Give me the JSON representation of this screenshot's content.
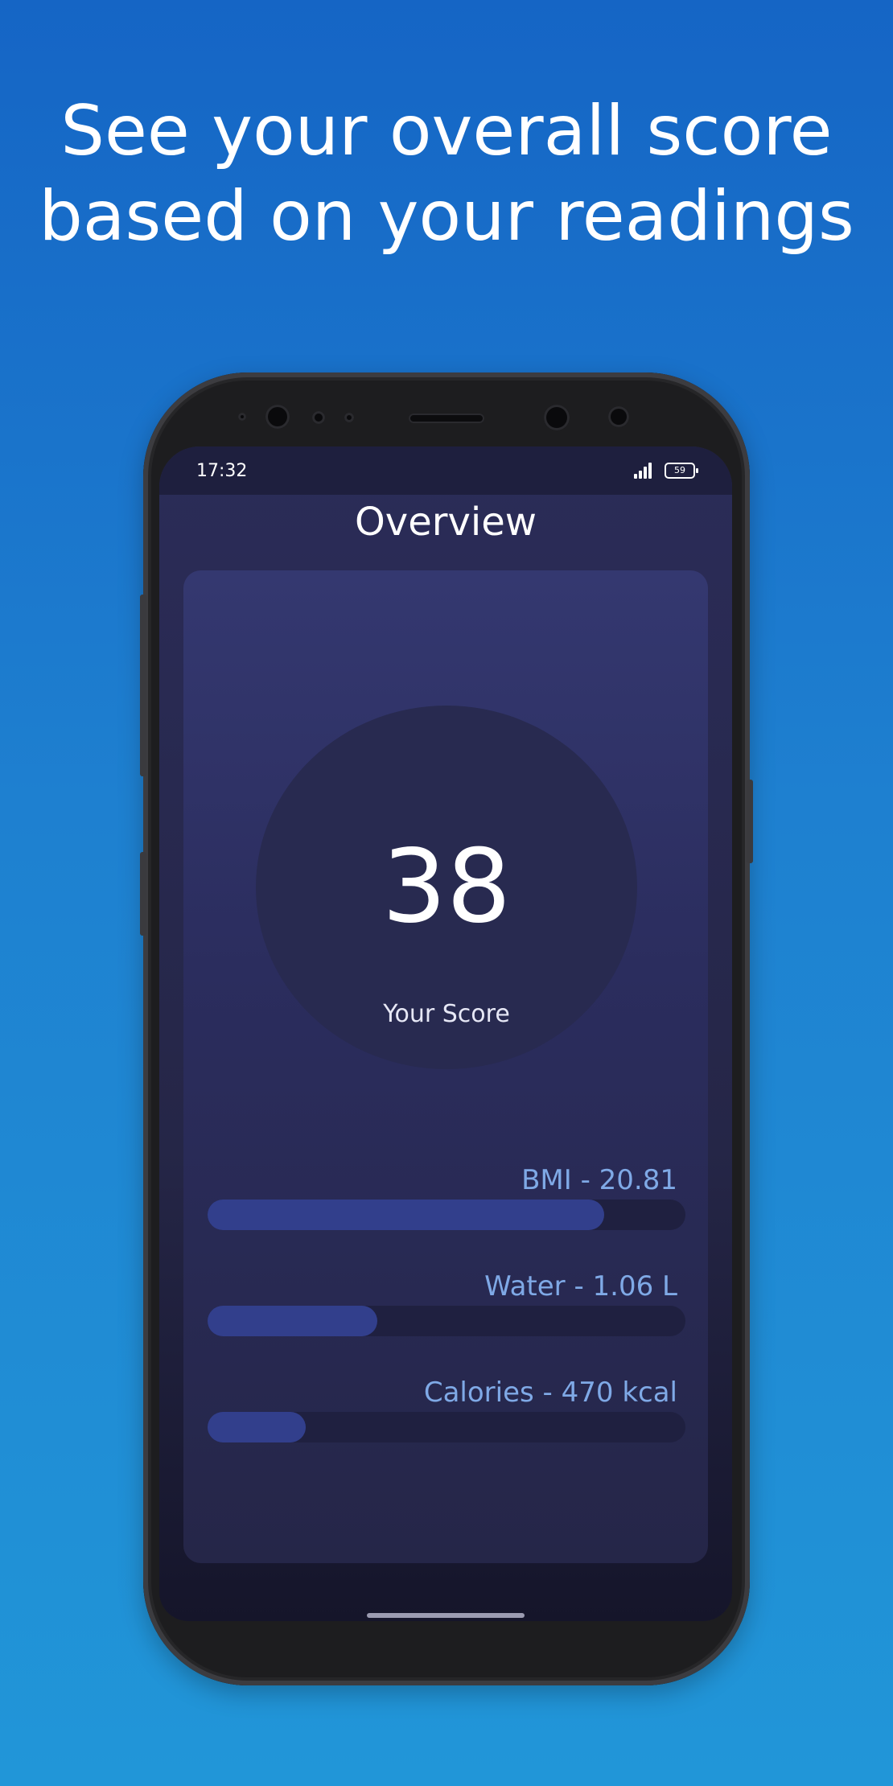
{
  "headline": {
    "line1": "See your overall score",
    "line2": "based on your readings"
  },
  "status_bar": {
    "time": "17:32",
    "battery": "59",
    "icons": [
      "signal-icon",
      "battery-icon"
    ]
  },
  "screen": {
    "title": "Overview",
    "score": {
      "value": "38",
      "label": "Your Score"
    },
    "metrics": [
      {
        "label": "BMI - 20.81",
        "progress": 0.83
      },
      {
        "label": "Water - 1.06 L",
        "progress": 0.355
      },
      {
        "label": "Calories - 470 kcal",
        "progress": 0.205
      }
    ]
  },
  "colors": {
    "background_top": "#1565c5",
    "background_bottom": "#2196d8",
    "accent_label": "#7fa9e6",
    "progress_fill": "#323f8c",
    "progress_track": "#1f2040",
    "card": "#2b2d5e"
  }
}
